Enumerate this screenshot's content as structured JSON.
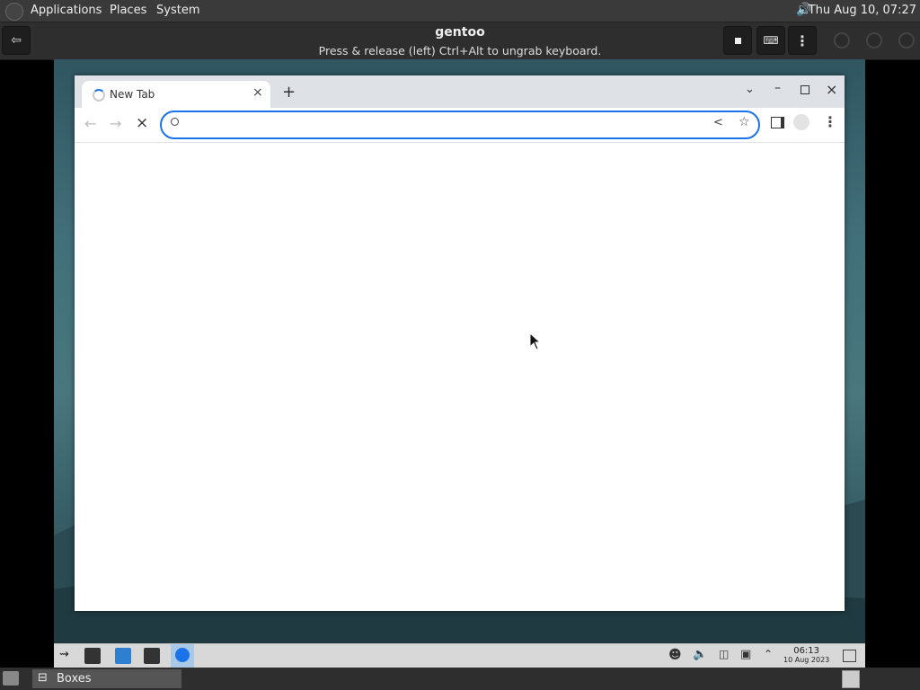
{
  "host_panel": {
    "menus": [
      "Applications",
      "Places",
      "System"
    ],
    "clock": "Thu Aug 10, 07:27"
  },
  "boxes": {
    "title": "gentoo",
    "subtitle": "Press & release (left) Ctrl+Alt to ungrab keyboard."
  },
  "chrome": {
    "tab_title": "New Tab",
    "omnibox_value": "",
    "accent": "#1a73e8"
  },
  "guest_panel": {
    "time": "06:13",
    "date": "10 Aug 2023"
  },
  "host_bottom": {
    "task_label": "Boxes"
  }
}
